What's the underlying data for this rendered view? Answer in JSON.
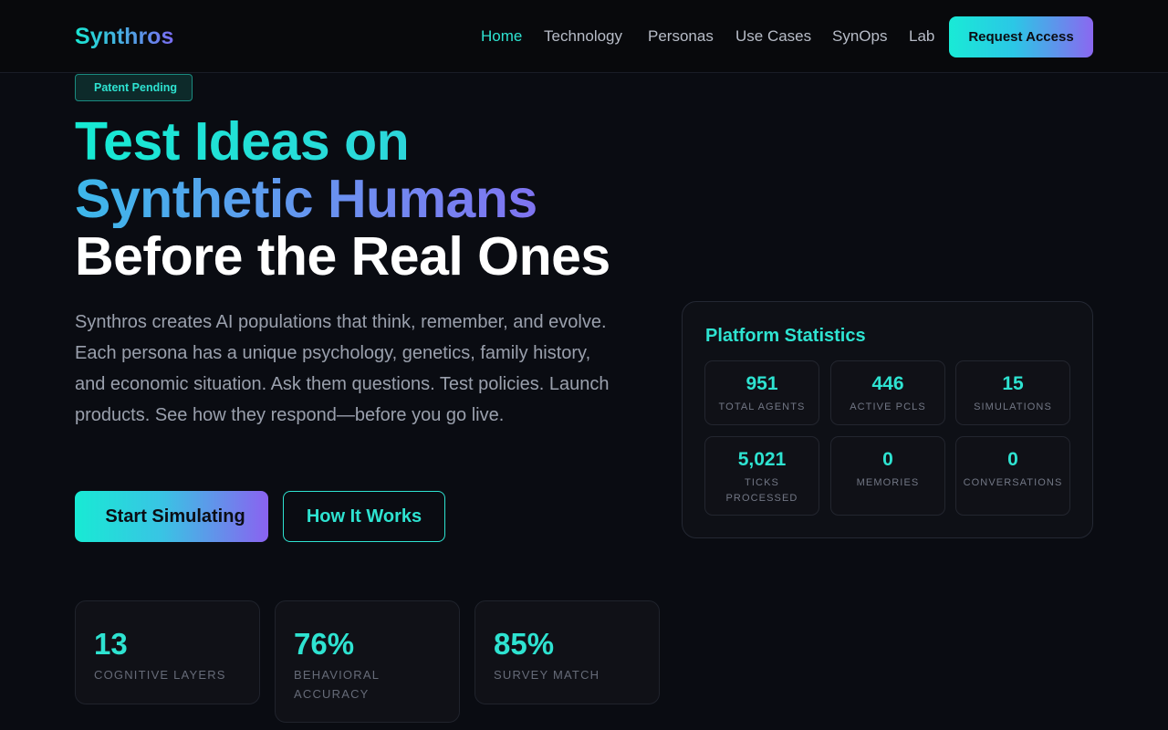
{
  "nav": {
    "logo": "Synthros",
    "links": [
      "Home",
      "Technology",
      "Personas",
      "Use Cases",
      "SynOps",
      "Lab"
    ],
    "active": "Home",
    "cta": "Request Access"
  },
  "hero": {
    "badge_icon": "",
    "badge": "Patent Pending",
    "headline": [
      "Test Ideas on",
      "Synthetic Humans",
      "Before the Real Ones"
    ],
    "description": "Synthros creates AI populations that think, remember, and evolve. Each persona has a unique psychology, genetics, family history, and economic situation. Ask them questions. Test policies. Launch products. See how they respond—before you go live.",
    "primary_button_icon": "",
    "primary_button": "Start Simulating",
    "secondary_button": "How It Works"
  },
  "metrics": [
    {
      "value": "13",
      "label": "Cognitive Layers"
    },
    {
      "value": "76%",
      "label": "Behavioral Accuracy"
    },
    {
      "value": "85%",
      "label": "Survey Match"
    }
  ],
  "platform_stats": {
    "icon": "",
    "title": "Platform Statistics",
    "items": [
      {
        "value": "951",
        "label": "Total Agents"
      },
      {
        "value": "446",
        "label": "Active PCLs"
      },
      {
        "value": "15",
        "label": "Simulations"
      },
      {
        "value": "5,021",
        "label": "Ticks Processed"
      },
      {
        "value": "0",
        "label": "Memories"
      },
      {
        "value": "0",
        "label": "Conversations"
      }
    ]
  },
  "colors": {
    "background": "#0a0c12",
    "accent": "#2ee3d1",
    "gradient_start": "#18ead4",
    "gradient_end": "#8a62f0"
  }
}
